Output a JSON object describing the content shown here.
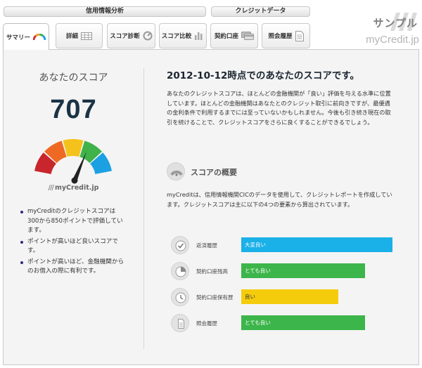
{
  "nav": {
    "group_left": "信用情報分析",
    "group_right": "クレジットデータ",
    "tabs": [
      {
        "label": "サマリー",
        "icon": "rainbow-gauge-icon",
        "active": true
      },
      {
        "label": "詳細",
        "icon": "table-icon"
      },
      {
        "label": "スコア診断",
        "icon": "dial-icon"
      },
      {
        "label": "スコア比較",
        "icon": "bar-chart-icon"
      },
      {
        "label": "契約口座",
        "icon": "card-icon"
      },
      {
        "label": "照会履歴",
        "icon": "document-icon"
      }
    ]
  },
  "watermark": {
    "sample": "サンプル",
    "logo": "myCredit.jp"
  },
  "summary": {
    "your_score_label": "あなたのスコア",
    "score": "707",
    "logo_text": "myCredit.jp",
    "notes": [
      "myCreditのクレジットスコアは300から850ポイントで評価しています。",
      "ポイントが高いほど良いスコアです。",
      "ポイントが高いほど、金融機関からのお借入の際に有利です。"
    ]
  },
  "gauge": {
    "colors": [
      "#c8262c",
      "#ee6a24",
      "#f4c21a",
      "#3fb24a",
      "#1ba1e2"
    ]
  },
  "detail": {
    "headline": "2012-10-12時点でのあなたのスコアです。",
    "description": "あなたのクレジットスコアは、ほとんどの金融機関が「良い」評価を与える水準に位置しています。ほとんどの金融機関はあなたとのクレジット取引に前向きですが、最優遇の金利条件で利用するまでには至っていないかもしれません。今後も引き続き現在の取引を続けることで、クレジットスコアをさらに良くすることができるでしょう。",
    "overview_title": "スコアの概要",
    "overview_text": "myCreditは、信用情報機関CICのデータを使用して、クレジットレポートを作成しています。クレジットスコアは主に以下の4つの要素から算出されています。",
    "factors": [
      {
        "name": "返済履歴",
        "rating": "大変良い",
        "color": "#1ab0e8",
        "level": 1.0,
        "icon": "check-coin-icon"
      },
      {
        "name": "契約口座残高",
        "rating": "とても良い",
        "color": "#3cb54a",
        "level": 0.82,
        "icon": "pie-chart-icon"
      },
      {
        "name": "契約口座保有歴",
        "rating": "良い",
        "color": "#f5cc0c",
        "level": 0.64,
        "icon": "clock-icon"
      },
      {
        "name": "照会履歴",
        "rating": "とても良い",
        "color": "#3cb54a",
        "level": 0.82,
        "icon": "document-icon"
      }
    ]
  }
}
